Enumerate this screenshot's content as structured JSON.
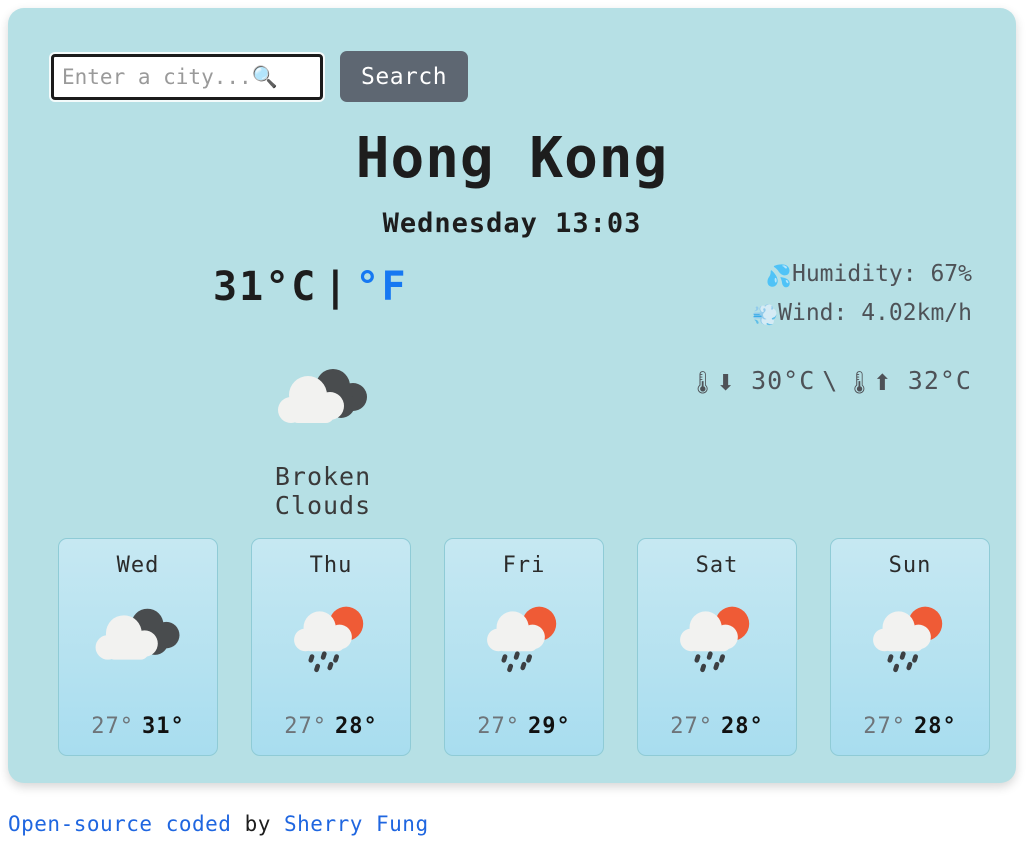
{
  "search": {
    "placeholder": "Enter a city...🔍",
    "value": "",
    "button_label": "Search",
    "search_icon": "search-icon"
  },
  "current": {
    "city": "Hong Kong",
    "date_time": "Wednesday 13:03",
    "temperature": "31°C",
    "divider": "|",
    "alt_unit": "°F",
    "condition": "Broken Clouds",
    "condition_icon": "broken-clouds-icon",
    "humidity_icon": "💦",
    "humidity_label": "Humidity: 67%",
    "wind_icon": "💨",
    "wind_label": "Wind: 4.02km/h",
    "temp_min_icon": "🌡⬇",
    "temp_min": "30°C",
    "minmax_separator": "\\",
    "temp_max_icon": "🌡⬆",
    "temp_max": "32°C"
  },
  "forecast": [
    {
      "day": "Wed",
      "icon": "broken-clouds-icon",
      "min": "27°",
      "max": "31°"
    },
    {
      "day": "Thu",
      "icon": "sun-rain-icon",
      "min": "27°",
      "max": "28°"
    },
    {
      "day": "Fri",
      "icon": "sun-rain-icon",
      "min": "27°",
      "max": "29°"
    },
    {
      "day": "Sat",
      "icon": "sun-rain-icon",
      "min": "27°",
      "max": "28°"
    },
    {
      "day": "Sun",
      "icon": "sun-rain-icon",
      "min": "27°",
      "max": "28°"
    }
  ],
  "footer": {
    "link1": "Open-source coded",
    "middle": " by ",
    "link2": "Sherry Fung"
  },
  "colors": {
    "page_background": "#ffffff",
    "panel_background": "#b6e0e5",
    "search_button": "#5e6772",
    "link_blue": "#1f66e0",
    "unit_blue": "#1678f2",
    "card_gradient_top": "#c6e8f2",
    "card_gradient_bottom": "#a8ddef",
    "cloud_white": "#f2f2f0",
    "cloud_dark": "#494c4e",
    "sun_orange": "#ef5b36"
  }
}
